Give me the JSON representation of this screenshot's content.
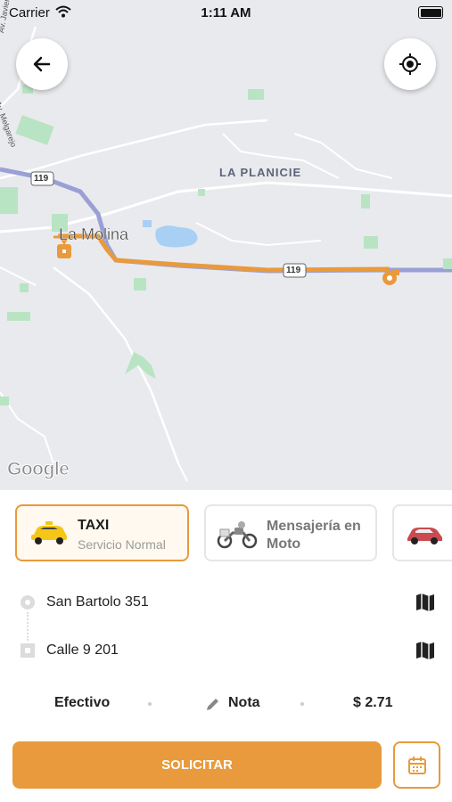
{
  "status_bar": {
    "carrier": "Carrier",
    "time": "1:11 AM"
  },
  "map": {
    "labels": {
      "la_planicie": "LA PLANICIE",
      "la_molina": "La Molina",
      "route_119_a": "119",
      "route_119_b": "119",
      "av_javier": "Av. Javier",
      "av_melgarejo": "Av. Melgarejo"
    },
    "attribution": "Google",
    "colors": {
      "route": "#e89a3c",
      "road": "#9aa0d6",
      "water": "#a8d0f5",
      "park": "#b9e4c4"
    }
  },
  "header": {
    "back_icon": "arrow-left-icon",
    "locate_icon": "crosshair-location-icon"
  },
  "services": [
    {
      "title": "TAXI",
      "subtitle": "Servicio Normal",
      "icon": "taxi-car-icon",
      "active": true
    },
    {
      "title": "Mensajería en Moto",
      "icon": "motorcycle-icon",
      "active": false
    },
    {
      "title": "",
      "icon": "red-car-icon",
      "active": false
    }
  ],
  "route": {
    "origin": "San Bartolo 351",
    "destination": "Calle 9 201"
  },
  "options": {
    "payment": "Efectivo",
    "note": "Nota",
    "price": "$ 2.71"
  },
  "actions": {
    "request_label": "SOLICITAR",
    "schedule_icon": "calendar-icon"
  },
  "accent_color": "#e89a3c"
}
